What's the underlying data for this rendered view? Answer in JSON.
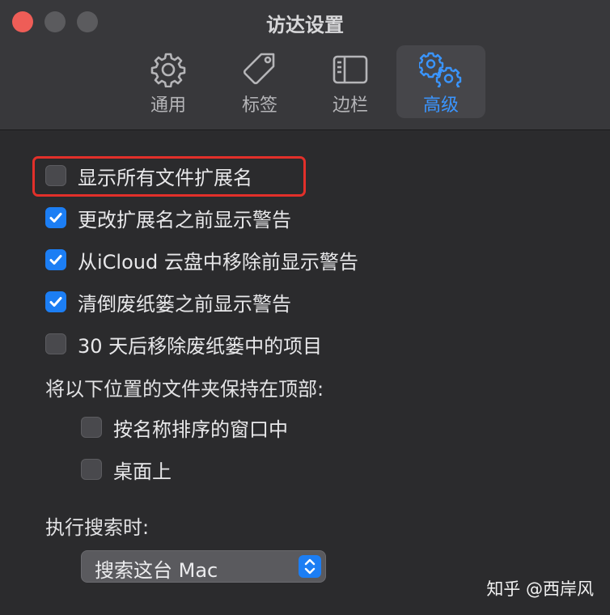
{
  "window": {
    "title": "访达设置"
  },
  "tabs": [
    {
      "label": "通用",
      "icon": "gear-icon",
      "active": false
    },
    {
      "label": "标签",
      "icon": "tag-icon",
      "active": false
    },
    {
      "label": "边栏",
      "icon": "sidebar-icon",
      "active": false
    },
    {
      "label": "高级",
      "icon": "gears-icon",
      "active": true
    }
  ],
  "options": [
    {
      "label": "显示所有文件扩展名",
      "checked": false,
      "highlighted": true
    },
    {
      "label": "更改扩展名之前显示警告",
      "checked": true
    },
    {
      "label": "从iCloud 云盘中移除前显示警告",
      "checked": true
    },
    {
      "label": "清倒废纸篓之前显示警告",
      "checked": true
    },
    {
      "label": "30 天后移除废纸篓中的项目",
      "checked": false
    }
  ],
  "folders_on_top": {
    "label": "将以下位置的文件夹保持在顶部:",
    "options": [
      {
        "label": "按名称排序的窗口中",
        "checked": false
      },
      {
        "label": "桌面上",
        "checked": false
      }
    ]
  },
  "search": {
    "label": "执行搜索时:",
    "selected": "搜索这台 Mac"
  },
  "watermark": "知乎 @西岸风",
  "colors": {
    "accent": "#1c7ef4",
    "highlight_box": "#e2302a",
    "close_button": "#ee5d57"
  }
}
